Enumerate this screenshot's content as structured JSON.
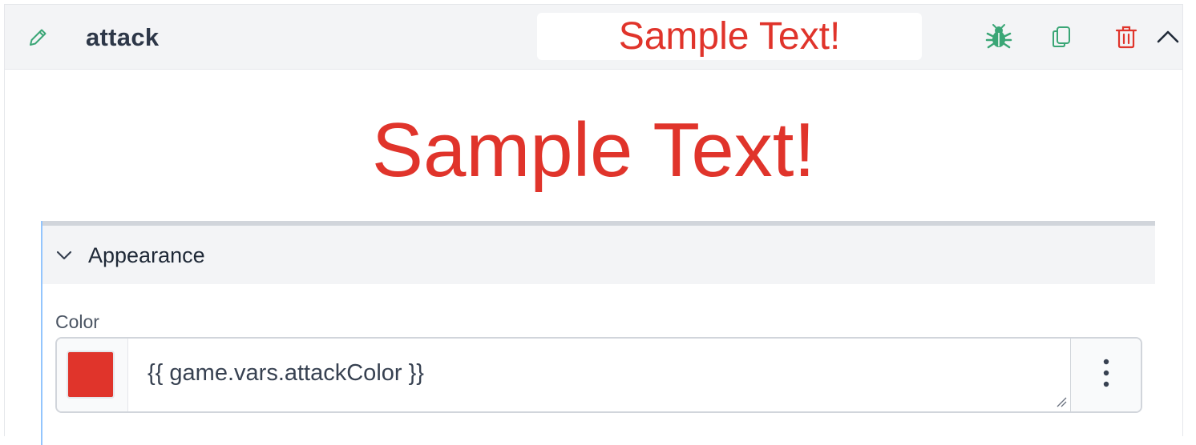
{
  "component": {
    "name": "attack",
    "preview_text": "Sample Text!",
    "preview_color": "#e0342b"
  },
  "header_actions": {
    "edit_icon": "pencil-icon",
    "debug_icon": "bug-icon",
    "duplicate_icon": "copy-icon",
    "delete_icon": "trash-icon",
    "collapse_icon": "chevron-up-icon"
  },
  "section": {
    "title": "Appearance",
    "expanded": true
  },
  "color_field": {
    "label": "Color",
    "value": "{{ game.vars.attackColor }}",
    "swatch_color": "#e0342b",
    "menu_icon": "more-vertical-icon"
  },
  "colors": {
    "accent_green": "#3aa676",
    "danger_red": "#e0342b",
    "header_bg": "#f3f4f6",
    "focus_border": "#93c5fd"
  }
}
